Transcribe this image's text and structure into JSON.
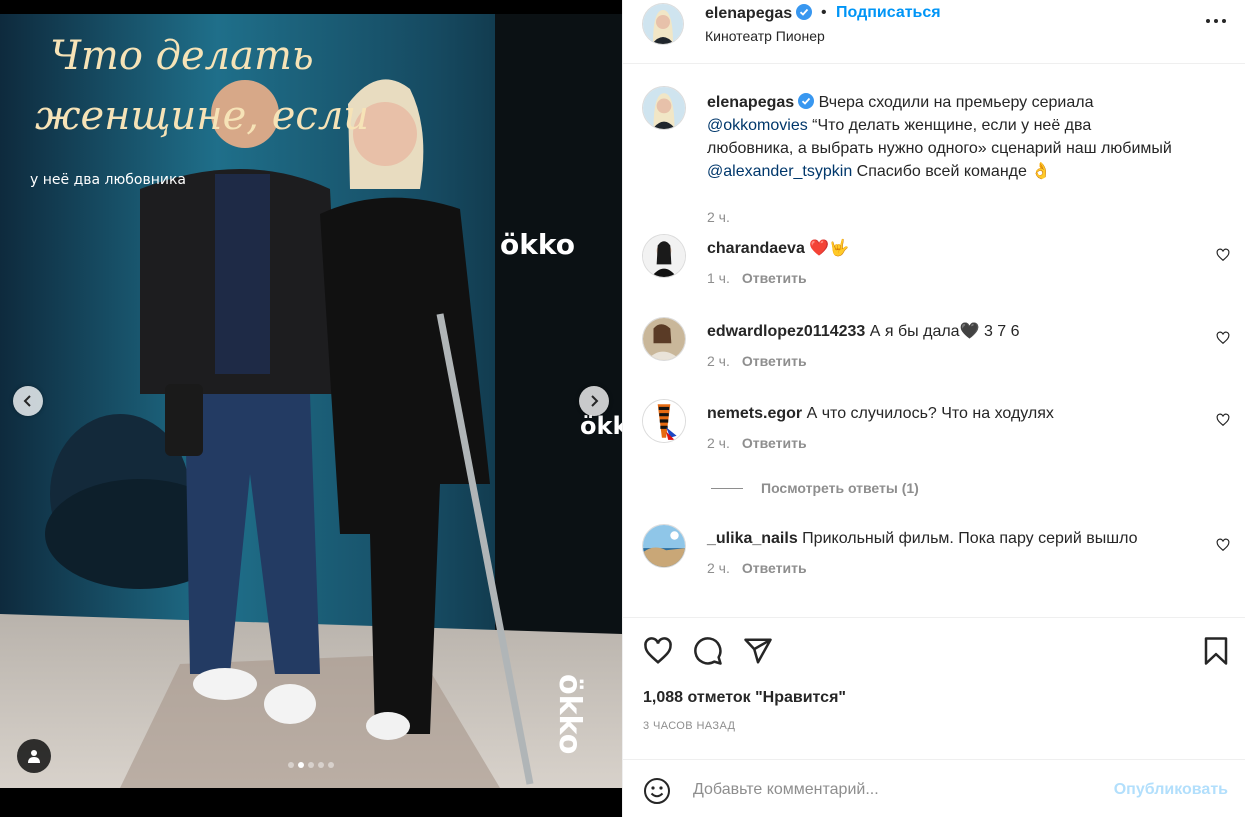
{
  "post": {
    "username": "elenapegas",
    "follow_label": "Подписаться",
    "location": "Кинотеатр Пионер",
    "caption": {
      "author": "elenapegas",
      "text_1": "Вчера сходили на премьеру сериала",
      "mention_1": "@okkomovies",
      "text_2": "“Что делать женщине, если у неё два любовника, а выбрать нужно одного» сценарий наш любимый",
      "mention_2": "@alexander_tsypkin",
      "text_3": "Спасибо всей команде 👌",
      "time": "2 ч."
    },
    "photo": {
      "sign_title_line1": "Что делать",
      "sign_title_line2": "женщине, если",
      "sign_sub": "у неё два любовника",
      "brand": "ökko"
    },
    "comments": [
      {
        "user": "charandaeva",
        "text": "❤️🤟",
        "time": "1 ч.",
        "reply": "Ответить"
      },
      {
        "user": "edwardlopez0114233",
        "text": "А я бы дала🖤 3 7 6",
        "time": "2 ч.",
        "reply": "Ответить"
      },
      {
        "user": "nemets.egor",
        "text": "А что случилось? Что на ходулях",
        "time": "2 ч.",
        "reply": "Ответить"
      },
      {
        "user": "_ulika_nails",
        "text": "Прикольный фильм. Пока пару серий вышло",
        "time": "2 ч.",
        "reply": "Ответить"
      }
    ],
    "view_replies": "Посмотреть ответы (1)",
    "likes": "1,088 отметок \"Нравится\"",
    "posted": "3 ЧАСОВ НАЗАД",
    "comment_placeholder": "Добавьте комментарий...",
    "publish_label": "Опубликовать",
    "carousel": {
      "count": 5,
      "active": 2
    }
  },
  "colors": {
    "link": "#0095f6",
    "mention": "#00376b",
    "muted": "#8e8e8e",
    "text": "#262626",
    "verified": "#3897f0"
  },
  "icons": [
    "chevron-left-icon",
    "chevron-right-icon",
    "user-tag-icon",
    "verified-icon",
    "more-icon",
    "heart-icon",
    "comment-icon",
    "share-icon",
    "bookmark-icon",
    "emoji-icon"
  ]
}
